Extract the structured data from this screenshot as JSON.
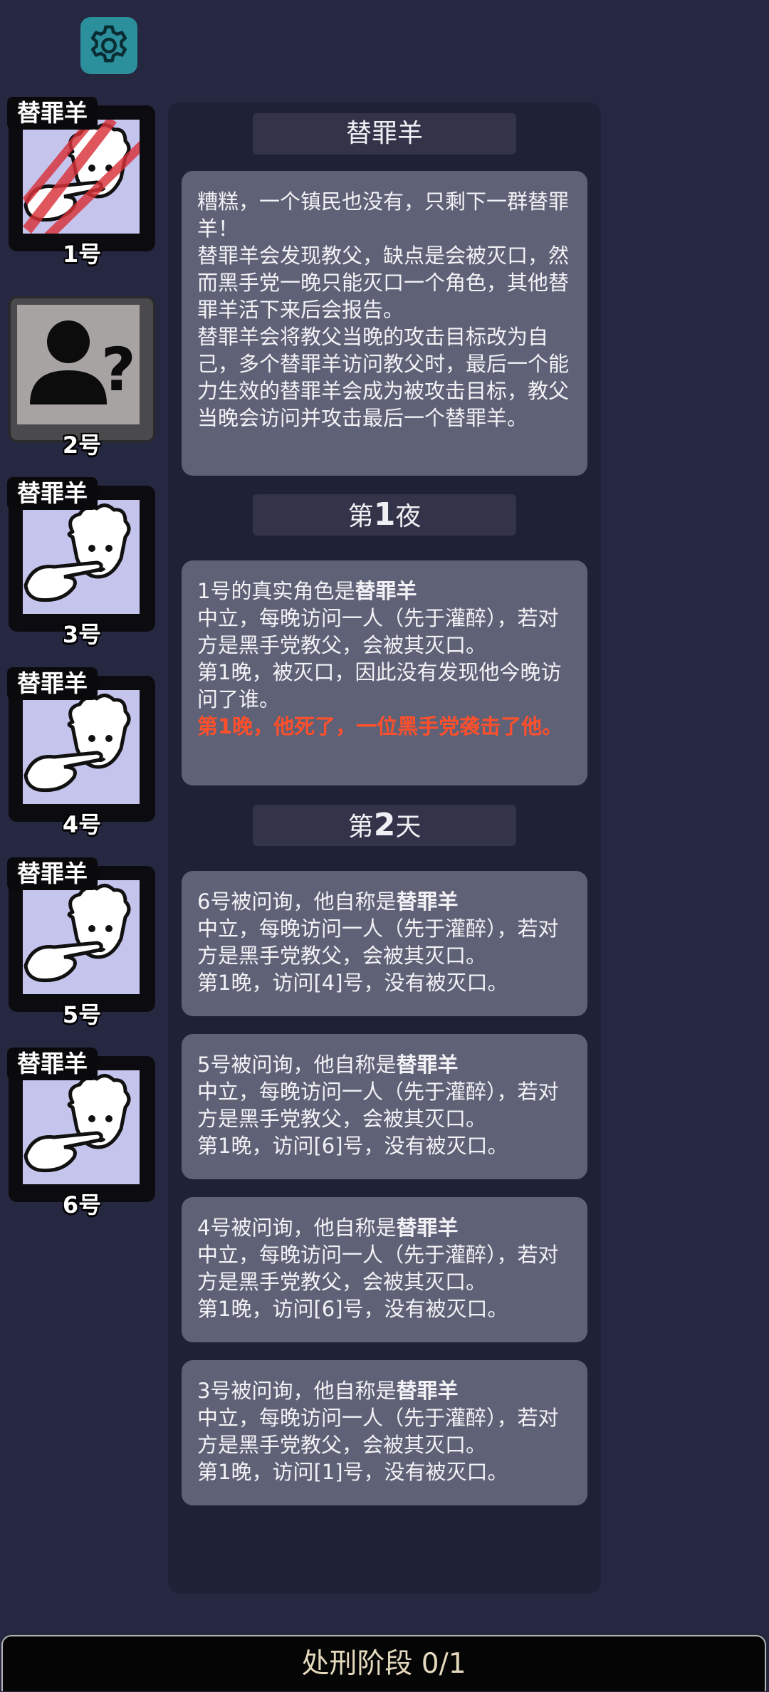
{
  "settings": {
    "icon": "gear-icon",
    "color": "#2b8f9c"
  },
  "players": [
    {
      "number": "1号",
      "role": "替罪羊",
      "state": "dead"
    },
    {
      "number": "2号",
      "role": "",
      "state": "unknown"
    },
    {
      "number": "3号",
      "role": "替罪羊",
      "state": "alive"
    },
    {
      "number": "4号",
      "role": "替罪羊",
      "state": "alive"
    },
    {
      "number": "5号",
      "role": "替罪羊",
      "state": "alive"
    },
    {
      "number": "6号",
      "role": "替罪羊",
      "state": "alive"
    }
  ],
  "log": {
    "intro_title": "替罪羊",
    "intro_text": "糟糕，一个镇民也没有，只剩下一群替罪羊！\n替罪羊会发现教父，缺点是会被灭口，然而黑手党一晚只能灭口一个角色，其他替罪羊活下来后会报告。\n替罪羊会将教父当晚的攻击目标改为自己，多个替罪羊访问教父时，最后一个能力生效的替罪羊会成为被攻击目标，教父当晚会访问并攻击最后一个替罪羊。",
    "night1": {
      "prefix": "第",
      "num": "1",
      "suffix": "夜",
      "msg": {
        "lead": "1号的真实角色是",
        "role": "替罪羊",
        "line1": "中立，每晚访问一人（先于灌醉），若对方是黑手党教父，会被其灭口。",
        "line2": "第1晚，被灭口，因此没有发现他今晚访问了谁。",
        "alert": "第1晚，他死了，一位黑手党袭击了他。"
      }
    },
    "day2": {
      "prefix": "第",
      "num": "2",
      "suffix": "天",
      "messages": [
        {
          "lead": "6号被问询，他自称是",
          "role": "替罪羊",
          "line1": "中立，每晚访问一人（先于灌醉），若对方是黑手党教父，会被其灭口。",
          "line2": "第1晚，访问[4]号，没有被灭口。"
        },
        {
          "lead": "5号被问询，他自称是",
          "role": "替罪羊",
          "line1": "中立，每晚访问一人（先于灌醉），若对方是黑手党教父，会被其灭口。",
          "line2": "第1晚，访问[6]号，没有被灭口。"
        },
        {
          "lead": "4号被问询，他自称是",
          "role": "替罪羊",
          "line1": "中立，每晚访问一人（先于灌醉），若对方是黑手党教父，会被其灭口。",
          "line2": "第1晚，访问[6]号，没有被灭口。"
        },
        {
          "lead": "3号被问询，他自称是",
          "role": "替罪羊",
          "line1": "中立，每晚访问一人（先于灌醉），若对方是黑手党教父，会被其灭口。",
          "line2": "第1晚，访问[1]号，没有被灭口。"
        }
      ]
    }
  },
  "execution": {
    "label": "处刑阶段 0/1"
  },
  "colors": {
    "background": "#252840",
    "card_inner": "#c5c4ed",
    "alert": "#ff4f2b",
    "message_bg": "#5f6176"
  }
}
